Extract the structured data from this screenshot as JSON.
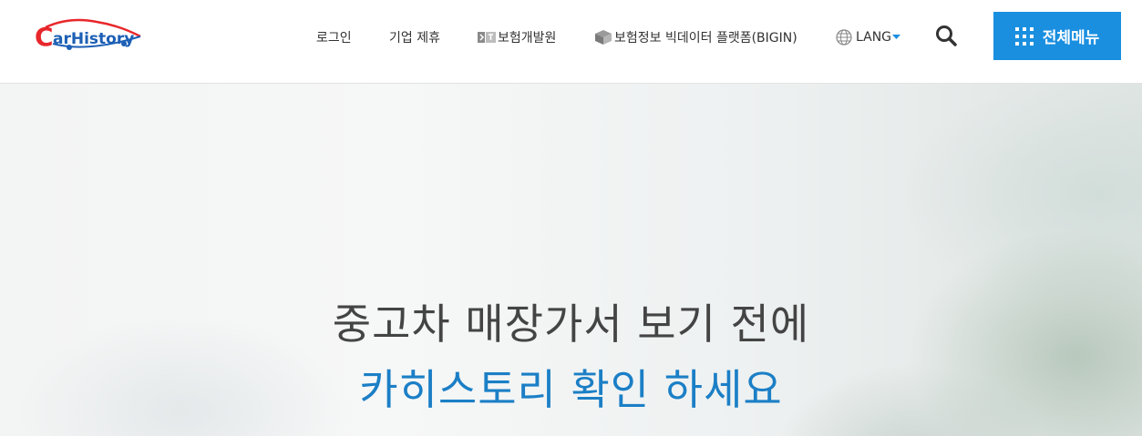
{
  "header": {
    "logo_text": "CarHistory",
    "nav": {
      "login": "로그인",
      "partnership": "기업 제휴",
      "kidi": "보험개발원",
      "bigin": "보험정보 빅데이터 플랫폼(BIGIN)",
      "lang": "LANG"
    },
    "menu_label": "전체메뉴"
  },
  "hero": {
    "line1": "중고차 매장가서 보기 전에",
    "line2": "카히스토리 확인 하세요"
  },
  "colors": {
    "accent": "#1a8fe0",
    "highlight_text": "#1b7fc6",
    "logo_red": "#e8272b",
    "logo_blue": "#1c5fb5"
  },
  "icons": [
    "car-logo-icon",
    "kidi-icon",
    "bigin-icon",
    "globe-icon",
    "caret-down-icon",
    "search-icon",
    "grid-menu-icon"
  ]
}
